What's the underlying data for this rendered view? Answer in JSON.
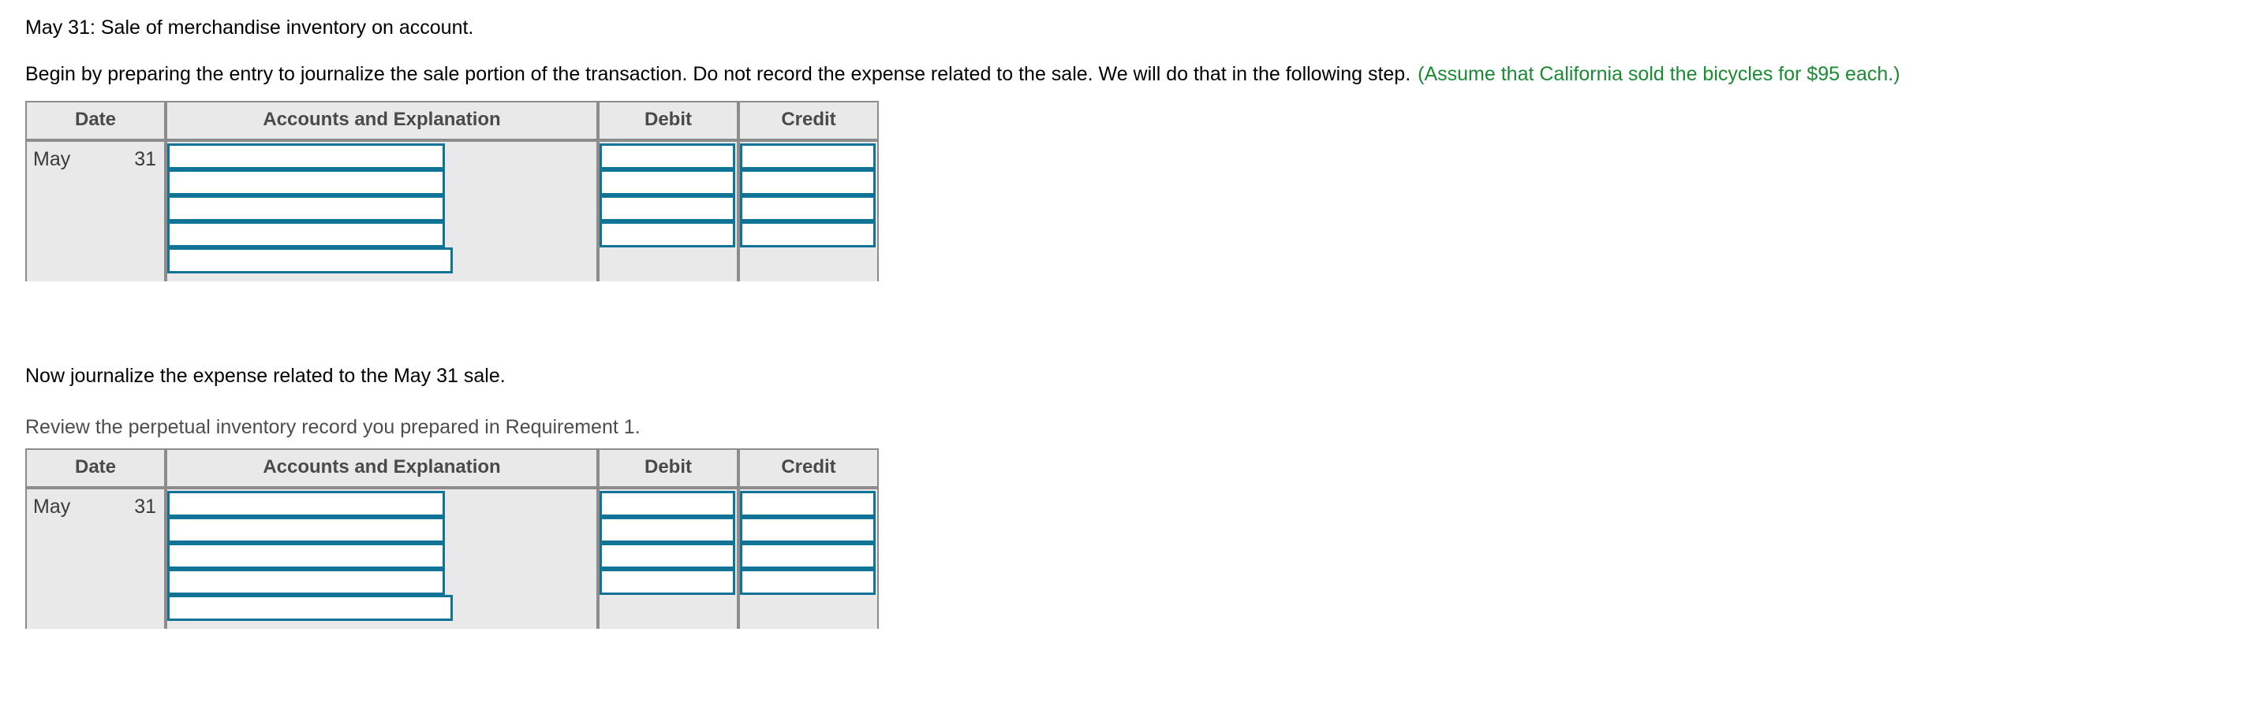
{
  "prompt": {
    "transaction_line": "May 31: Sale of merchandise inventory on account.",
    "instruction_part1": "Begin by preparing the entry to journalize the sale portion of the transaction. Do not record the expense related to the sale. We will do that in the following step.",
    "instruction_hint": "(Assume that California sold the bicycles for $95 each.)",
    "step2_instruction": "Now journalize the expense related to the May 31 sale.",
    "step2_subnote": "Review the perpetual inventory record you prepared in Requirement 1."
  },
  "colors": {
    "hint_green": "#1a8a33",
    "input_border_teal": "#117396",
    "table_bg": "#e9e9e9",
    "table_border": "#8c8c8c",
    "header_text": "#4a4a4a"
  },
  "journal_entry_1": {
    "headers": [
      "Date",
      "Accounts and Explanation",
      "Debit",
      "Credit"
    ],
    "date": {
      "month": "May",
      "day": "31"
    },
    "rows": [
      {
        "account": "",
        "debit": "",
        "credit": "",
        "has_debit": true,
        "has_credit": true
      },
      {
        "account": "",
        "debit": "",
        "credit": "",
        "has_debit": true,
        "has_credit": true
      },
      {
        "account": "",
        "debit": "",
        "credit": "",
        "has_debit": true,
        "has_credit": true
      },
      {
        "account": "",
        "debit": "",
        "credit": "",
        "has_debit": true,
        "has_credit": true
      },
      {
        "account": "",
        "debit": "",
        "credit": "",
        "has_debit": false,
        "has_credit": false
      }
    ]
  },
  "journal_entry_2": {
    "headers": [
      "Date",
      "Accounts and Explanation",
      "Debit",
      "Credit"
    ],
    "date": {
      "month": "May",
      "day": "31"
    },
    "rows": [
      {
        "account": "",
        "debit": "",
        "credit": "",
        "has_debit": true,
        "has_credit": true
      },
      {
        "account": "",
        "debit": "",
        "credit": "",
        "has_debit": true,
        "has_credit": true
      },
      {
        "account": "",
        "debit": "",
        "credit": "",
        "has_debit": true,
        "has_credit": true
      },
      {
        "account": "",
        "debit": "",
        "credit": "",
        "has_debit": true,
        "has_credit": true
      },
      {
        "account": "",
        "debit": "",
        "credit": "",
        "has_debit": false,
        "has_credit": false
      }
    ]
  }
}
